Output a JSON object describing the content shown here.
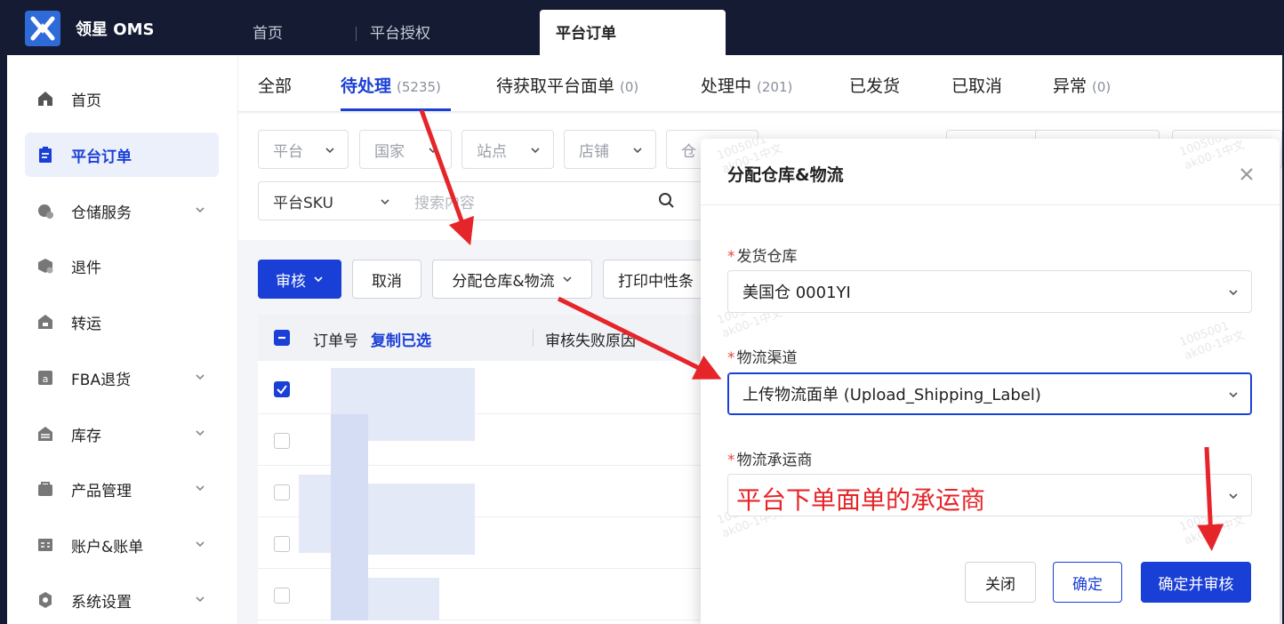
{
  "app": {
    "brand": "领星 OMS"
  },
  "top_tabs": [
    {
      "label": "首页"
    },
    {
      "label": "平台授权"
    },
    {
      "label": "平台订单"
    }
  ],
  "sidebar": {
    "items": [
      {
        "label": "首页",
        "icon": "home-icon"
      },
      {
        "label": "平台订单",
        "icon": "clipboard-icon"
      },
      {
        "label": "仓储服务",
        "icon": "warehouse-icon"
      },
      {
        "label": "退件",
        "icon": "return-icon"
      },
      {
        "label": "转运",
        "icon": "transfer-icon"
      },
      {
        "label": "FBA退货",
        "icon": "fba-icon"
      },
      {
        "label": "库存",
        "icon": "inventory-icon"
      },
      {
        "label": "产品管理",
        "icon": "product-icon"
      },
      {
        "label": "账户&账单",
        "icon": "account-icon"
      },
      {
        "label": "系统设置",
        "icon": "settings-icon"
      }
    ]
  },
  "status_tabs": [
    {
      "label": "全部",
      "count": ""
    },
    {
      "label": "待处理",
      "count": "(5235)"
    },
    {
      "label": "待获取平台面单",
      "count": "(0)"
    },
    {
      "label": "处理中",
      "count": "(201)"
    },
    {
      "label": "已发货",
      "count": ""
    },
    {
      "label": "已取消",
      "count": ""
    },
    {
      "label": "异常",
      "count": "(0)"
    }
  ],
  "filters": {
    "platform": "平台",
    "country": "国家",
    "site": "站点",
    "shop": "店铺",
    "warehouse_partial": "仓",
    "sku_type": "平台SKU",
    "search_placeholder": "搜索内容"
  },
  "actions": {
    "audit": "审核",
    "cancel": "取消",
    "assign": "分配仓库&物流",
    "print_partial": "打印中性条"
  },
  "table": {
    "col_order": "订单号",
    "copy_selected": "复制已选",
    "col_fail_reason": "审核失败原因"
  },
  "modal": {
    "title": "分配仓库&物流",
    "warehouse_label": "发货仓库",
    "warehouse_value": "美国仓 0001YI",
    "channel_label": "物流渠道",
    "channel_value": "上传物流面单 (Upload_Shipping_Label)",
    "carrier_label": "物流承运商",
    "carrier_annotation": "平台下单面单的承运商",
    "close_label": "关闭",
    "ok_label": "确定",
    "ok_audit_label": "确定并审核"
  },
  "watermark": {
    "line1": "1005001",
    "line2": "ak00-1中文"
  },
  "colors": {
    "primary": "#1a3fd6",
    "topbar": "#151b33",
    "annotation": "#e6252a"
  }
}
